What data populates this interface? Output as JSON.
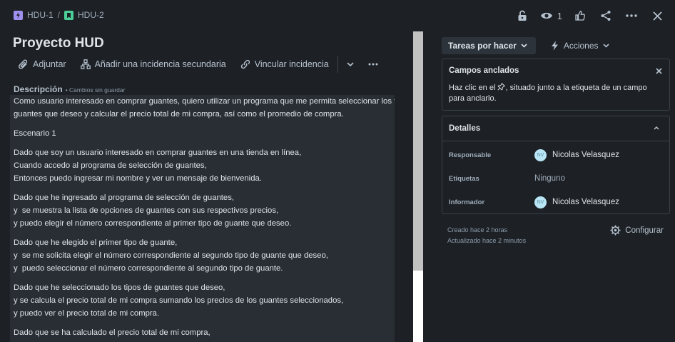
{
  "breadcrumb": {
    "parent": "HDU-1",
    "separator": "/",
    "current": "HDU-2"
  },
  "header_actions": {
    "watch_count": "1"
  },
  "issue": {
    "title": "Proyecto HUD"
  },
  "toolbar": {
    "attach_label": "Adjuntar",
    "child_issue_label": "Añadir una incidencia secundaria",
    "link_issue_label": "Vincular incidencia"
  },
  "description": {
    "label": "Descripción",
    "unsaved": "• Cambios sin guardar",
    "paragraphs": [
      "Como usuario interesado en comprar guantes, quiero utilizar un programa que me permita seleccionar los tipos de\nguantes que deseo y calcular el precio total de mi compra, así como el promedio de compra.",
      "Escenario 1",
      "Dado que soy un usuario interesado en comprar guantes en una tienda en línea,\nCuando accedo al programa de selección de guantes,\nEntonces puedo ingresar mi nombre y ver un mensaje de bienvenida.",
      "Dado que he ingresado al programa de selección de guantes,\ny  se muestra la lista de opciones de guantes con sus respectivos precios,\ny puedo elegir el número correspondiente al primer tipo de guante que deseo.",
      "Dado que he elegido el primer tipo de guante,\ny  se me solicita elegir el número correspondiente al segundo tipo de guante que deseo,\ny  puedo seleccionar el número correspondiente al segundo tipo de guante.",
      "Dado que he seleccionado los tipos de guantes que deseo,\ny se calcula el precio total de mi compra sumando los precios de los guantes seleccionados,\ny puedo ver el precio total de mi compra.",
      "Dado que se ha calculado el precio total de mi compra,"
    ]
  },
  "sidebar": {
    "status_label": "Tareas por hacer",
    "actions_label": "Acciones",
    "pinned": {
      "title": "Campos anclados",
      "text_before": "Haz clic en el",
      "text_after": ", situado junto a la etiqueta de un campo para anclarlo."
    },
    "details": {
      "title": "Detalles",
      "rows": [
        {
          "label": "Responsable",
          "value": "Nicolas Velasquez",
          "avatar": "NV"
        },
        {
          "label": "Etiquetas",
          "value": "Ninguno"
        },
        {
          "label": "Informador",
          "value": "Nicolas Velasquez",
          "avatar": "NV"
        }
      ]
    },
    "created": "Creado hace 2 horas",
    "updated": "Actualizado hace 2 minutos",
    "configure_label": "Configurar"
  },
  "colors": {
    "background": "#1d2125",
    "editor": "#282e33",
    "epic": "#9f8fef",
    "story": "#4bce97"
  }
}
